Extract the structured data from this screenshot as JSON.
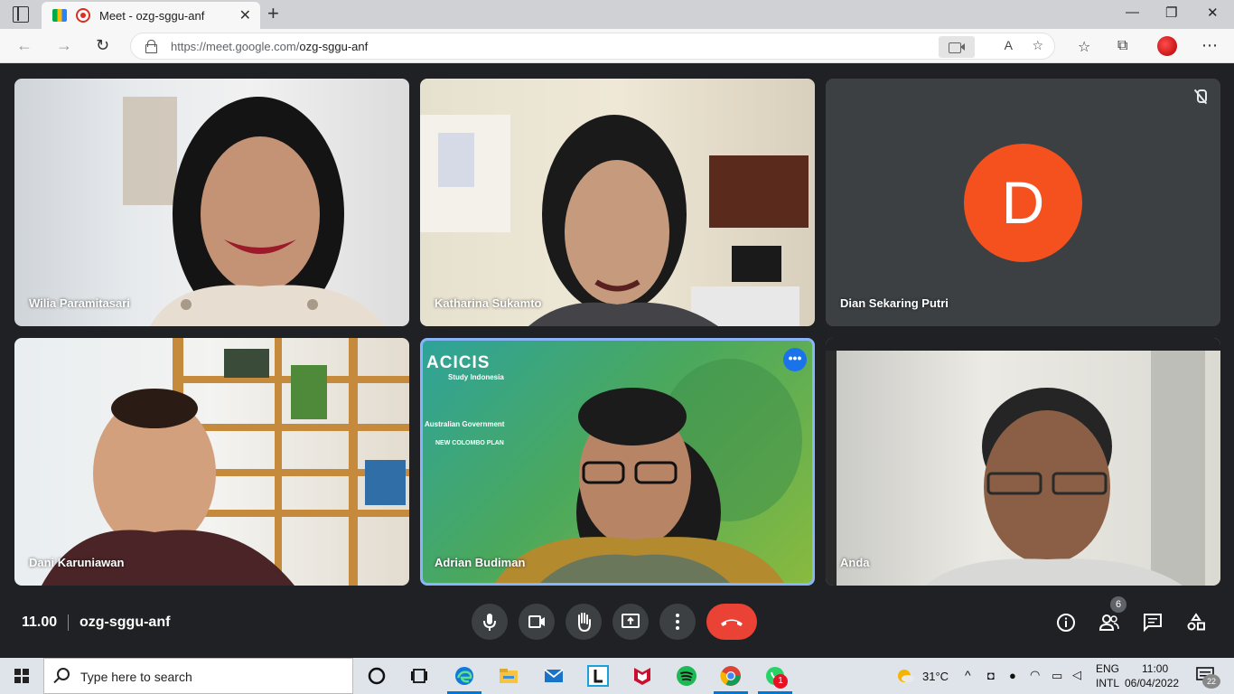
{
  "browser": {
    "tab_title": "Meet - ozg-sggu-anf",
    "tab_close": "✕",
    "new_tab": "+",
    "url_host": "https://meet.google.com/",
    "url_path": "ozg-sggu-anf",
    "read_aloud": "A",
    "window_controls": {
      "minimize": "—",
      "restore": "❐",
      "close": "✕"
    }
  },
  "participants": [
    {
      "name": "Wilia Paramitasari",
      "video": true
    },
    {
      "name": "Katharina Sukamto",
      "video": true
    },
    {
      "name": "Dian Sekaring Putri",
      "video": false,
      "avatar_letter": "D",
      "avatar_color": "#f4511e",
      "muted": true
    },
    {
      "name": "Dani Karuniawan",
      "video": true
    },
    {
      "name": "Adrian Budiman",
      "video": true,
      "active_speaker": true,
      "background": {
        "logo": "ACICIS",
        "logo_sub": "Study Indonesia",
        "gov": "Australian Government",
        "plan": "NEW COLOMBO PLAN"
      }
    },
    {
      "name": "Anda",
      "video": true
    }
  ],
  "meeting": {
    "time": "11.00",
    "code": "ozg-sggu-anf",
    "participants_count": "6",
    "end_color": "#ea4335"
  },
  "taskbar": {
    "search_placeholder": "Type here to search",
    "weather": "31°C",
    "lang_line1": "ENG",
    "lang_line2": "INTL",
    "clock_time": "11:00",
    "clock_date": "06/04/2022",
    "notifications": "22",
    "whatsapp_badge": "1"
  }
}
